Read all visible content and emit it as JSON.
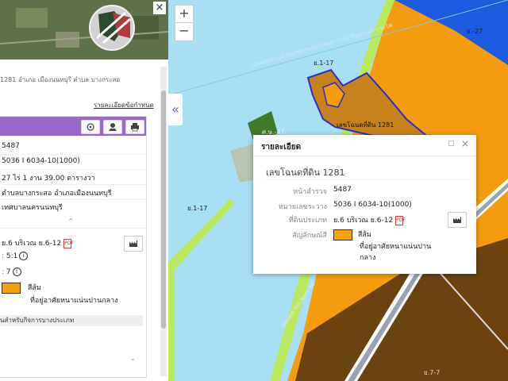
{
  "map": {
    "zoom_in": "+",
    "zoom_out": "−",
    "collapse_arrow": "«",
    "labels": {
      "r1_17_top": "ย.1-17",
      "r1_17_left": "ย.1-17",
      "r6_27": "ย.-27",
      "r7_7": "ย.7-7",
      "plot_label": "เลขโฉนดที่ดิน 1281",
      "green_label": "ศ.ษ.-47",
      "road_top": "Chaophraya Expressway Green Flag สัญญาณทางรถไฟ",
      "road_bottom": "Sanam Bin Nam Rd"
    },
    "colors": {
      "water": "#a7dff5",
      "orange": "#f59c0e",
      "blue": "#1c5ae0",
      "brown": "#6b430f",
      "lightgreen": "#b9ea5c",
      "darkgreen": "#3f7a28",
      "parcel_outline": "#2b2ccf"
    }
  },
  "left_panel": {
    "close": "×",
    "address": "1281 อำเภอ เมืองนนทบุรี ตำบล บางกระสอ",
    "terms_link": "รายละเอียดข้อกำหนด",
    "toolbar_icons": [
      "map-target-icon",
      "location-person-icon",
      "print-icon"
    ],
    "info_rows": [
      "5487",
      "5036 I 6034-10(1000)",
      "27 ไร่ 1 งาน 39.00 ตารางวา",
      "ตำบลบางกระสอ อำเภอเมืองนนทบุรี",
      "เทศบาลนครนนทบุรี"
    ],
    "zoning": {
      "code": "ย.6 บริเวณ ย.6-12",
      "ratio_1": "5:1",
      "ratio_2": "7",
      "color_name": "สีส้ม",
      "color_desc": "ที่อยู่อาศัยหนาแน่นปานกลาง"
    },
    "gray_row": "นสำหรับกิจการบางประเภท",
    "chevron_up": "^",
    "chevron_down": "⌄"
  },
  "popup": {
    "title": "รายละเอียด",
    "name": "เลขโฉนดที่ดิน 1281",
    "fields": [
      {
        "label": "หน้าสำรวจ",
        "value": "5487"
      },
      {
        "label": "หมายเลขระวาง",
        "value": "5036 I 6034-10(1000)"
      },
      {
        "label": "ที่ดินประเภท",
        "value": "ย.6 บริเวณ ย.6-12"
      },
      {
        "label": "สัญลักษณ์สี",
        "value": "สีส้ม"
      }
    ],
    "color_desc": "ที่อยู่อาศัยหนาแน่นปาน กลาง",
    "color_desc_line1": "ที่อยู่อาศัยหนาแน่นปาน",
    "color_desc_line2": "กลาง",
    "maximize": "▢",
    "close": "×"
  }
}
